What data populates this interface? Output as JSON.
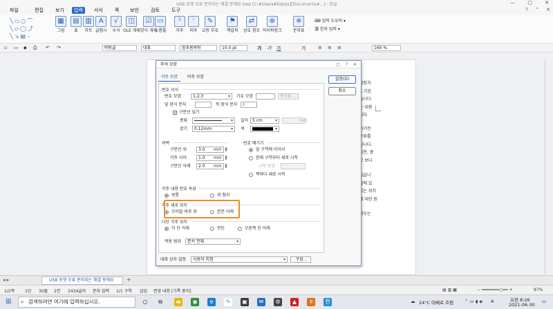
{
  "window": {
    "title": "USB 포맷 오류 준저지는 해결 문해요.hwp [C:#Users#Eqbgs][Documents#...] - 한글"
  },
  "menu": [
    "파일",
    "편집",
    "보기",
    "입력",
    "서식",
    "쪽",
    "보안",
    "검토",
    "도구"
  ],
  "menu_active": "입력",
  "ribbon": {
    "items": [
      "그림",
      "표",
      "차트",
      "글맵시",
      "수식",
      "OLE 개체",
      "양식 개체",
      "누름틀",
      "각주",
      "미주",
      "교정 부호",
      "책갈피",
      "상호 참조",
      "하이퍼링크",
      "문자표"
    ],
    "side": [
      "입력 도우미",
      "한자 입력"
    ]
  },
  "formatbar": {
    "style": "바탕글",
    "lang": "대표",
    "font": "함초롬바탕",
    "size": "10.0",
    "unit": "pt",
    "zoom": "160",
    "zoom_unit": "%"
  },
  "dialog": {
    "title": "주석 모양",
    "tabs": [
      "각주 모양",
      "미주 모양"
    ],
    "buttons": {
      "ok": "설정(D)",
      "cancel": "취소"
    },
    "number_format": {
      "section": "번호 서식",
      "label": "번호 모양",
      "value": "1,2,3",
      "symbol_label": "기호 모양",
      "char_btn": "문자표...",
      "prefix_label": "앞 장식 문자",
      "suffix_label": "뒤 장식 문자",
      "suffix_value": ")",
      "divider_label": "구분선 넣기",
      "kind_label": "종류",
      "length_label": "길이",
      "length_value": "5 cm",
      "length_mm": "mm",
      "width_label": "굵기",
      "width_value": "0.12mm",
      "color_label": "색"
    },
    "margins": {
      "section": "여백",
      "above_label": "구분선 위",
      "above_value": "3.0",
      "between_label": "각주 사이",
      "between_value": "1.0",
      "below_label": "구분선 아래",
      "below_value": "2.0",
      "unit": "mm"
    },
    "numbering": {
      "section": "번호 매기기",
      "opt1": "앞 구역에 이어서",
      "opt2": "현재 구역부터 새로 시작",
      "start_label": "시작 번호",
      "opt3": "쪽마다 새로 시작"
    },
    "attr": {
      "section": "각주 내용 번호 속성",
      "opt1": "보통",
      "opt2": "위 첨자"
    },
    "position": {
      "section": "각주 새로 위치",
      "opt1": "꼬리말 바로 위",
      "opt2": "본문 아래"
    },
    "multi": {
      "section": "다단 각주 위치",
      "opt1": "각 단 아래",
      "opt2": "전단",
      "opt3": "오른쪽 단 아래"
    },
    "scope": {
      "label": "적용 범위",
      "value": "문서 전체"
    },
    "bottom": {
      "label": "대화 상자 설정",
      "value": "사용자 지정",
      "btn": "구성..."
    }
  },
  "page_text": [
    "장장치",
    "), 기본",
    "습니다.",
    "는 대용",
    "니다.",
    "하기전",
    "오류를",
    "입니다.",
    "니만, 충",
    "고 보다",
    "있습니",
    "겉에 있",
    "있는 위치",
    "에 대한 원",
    "경우는"
  ],
  "tabbar": {
    "doc": "USB 포맷 오류 준저지는 해결 못해요",
    "add": "+"
  },
  "status": [
    "1/2쪽",
    "1단",
    "30줄",
    "2칸",
    "2434글자",
    "문자 입력",
    "1/1 구역",
    "삽입",
    "변경 내용 [기록 중지]",
    "97%"
  ],
  "taskbar": {
    "search": "검색하려면 여기에 입력하십시오.",
    "weather": "24°C 대체로 흐림",
    "time": "오전 8:26",
    "date": "2021-06-30",
    "lang": "A"
  }
}
